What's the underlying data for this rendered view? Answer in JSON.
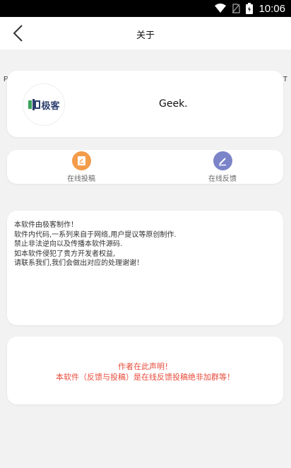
{
  "status_bar": {
    "time": "10:06"
  },
  "header": {
    "title": "关于"
  },
  "nav": {
    "prev": "PREV",
    "next": "NEXT"
  },
  "app": {
    "logo_text": "极客",
    "name": "Geek."
  },
  "actions": [
    {
      "label": "在线投稿",
      "icon": "document-icon",
      "color": "#f39c4a"
    },
    {
      "label": "在线反馈",
      "icon": "pencil-icon",
      "color": "#7b84c9"
    }
  ],
  "notice": {
    "lines": [
      "本软件由极客制作！",
      "软件内代码,一系列来自于网络,用户提议等原创制作.",
      "禁止非法逆向以及传播本软件源码.",
      "如本软件侵犯了贵方开发者权益,",
      "请联系我们,我们会做出对应的处理谢谢！"
    ]
  },
  "statement": {
    "line1": "作者在此声明！",
    "line2": "本软件（反馈与投稿）是在线反馈投稿绝非加群等！",
    "color": "#e74c3c"
  }
}
